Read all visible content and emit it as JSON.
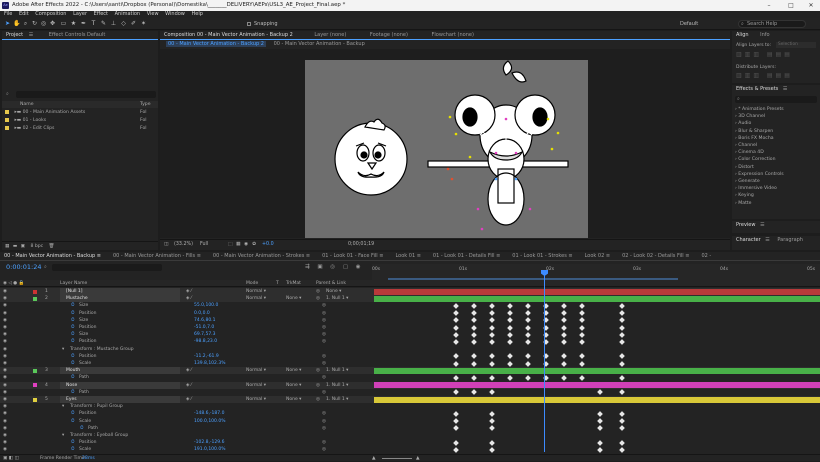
{
  "window": {
    "title": "Adobe After Effects 2022 - C:\\Users\\santi\\Dropbox (Personal)\\Domestika\\_______DELIVERY\\AEPs\\USL3_AE_Project_Final.aep *",
    "logo_text": "Ae"
  },
  "menu": [
    "File",
    "Edit",
    "Composition",
    "Layer",
    "Effect",
    "Animation",
    "View",
    "Window",
    "Help"
  ],
  "toolbar": {
    "snapping": "Snapping",
    "workspace": "Default",
    "search_placeholder": "Search Help"
  },
  "project_panel": {
    "tabs": [
      "Project",
      "Effect Controls Default"
    ],
    "columns": {
      "name": "Name",
      "type": "Type"
    },
    "items": [
      {
        "name": "00 - Main Animation Assets",
        "type": "Fol",
        "color": "#e6c84c"
      },
      {
        "name": "01 - Looks",
        "type": "Fol",
        "color": "#e6c84c"
      },
      {
        "name": "02 - Edit Clips",
        "type": "Fol",
        "color": "#e6c84c"
      }
    ],
    "footer": "8 bpc"
  },
  "comp_panel": {
    "tabs": [
      "Composition 00 - Main Vector Animation - Backup 2",
      "Layer (none)",
      "Footage (none)",
      "Flowchart (none)"
    ],
    "subtabs": [
      "00 - Main Vector Animation - Backup 2",
      "00 - Main Vector Animation - Backup"
    ],
    "zoom": "(33.2%)",
    "quality": "Full",
    "exposure": "+0.0",
    "timecode": "0;00;01;19"
  },
  "right_panel": {
    "align": {
      "tabs": [
        "Align",
        "Info"
      ],
      "align_to_label": "Align Layers to:",
      "align_to_value": "Selection",
      "distribute": "Distribute Layers:"
    },
    "effects": {
      "title": "Effects & Presets",
      "items": [
        "* Animation Presets",
        "3D Channel",
        "Audio",
        "Blur & Sharpen",
        "Boris FX Mocha",
        "Channel",
        "Cinema 4D",
        "Color Correction",
        "Distort",
        "Expression Controls",
        "Generate",
        "Immersive Video",
        "Keying",
        "Matte"
      ]
    },
    "preview": "Preview",
    "character_tabs": [
      "Character",
      "Paragraph"
    ]
  },
  "timeline": {
    "tabs": [
      "00 - Main Vector Animation - Backup",
      "00 - Main Vector Animation - Fills",
      "00 - Main Vector Animation - Strokes",
      "01 - Look 01 - Face Fill",
      "Look 01",
      "01 - Look 01 - Details Fill",
      "01 - Look 01 - Strokes",
      "Look 02",
      "02 - Look 02 - Details Fill",
      "02 -"
    ],
    "timecode": "0:00:01:24",
    "columns": {
      "layer_name": "Layer Name",
      "mode": "Mode",
      "t": "T",
      "trkmat": "TrkMat",
      "parent": "Parent & Link"
    },
    "ruler": [
      "00s",
      "01s",
      "02s",
      "03s",
      "04s",
      "05s"
    ],
    "footer": {
      "label": "Frame Render Time",
      "value": "28ms"
    },
    "rows": [
      {
        "num": "1",
        "name": "[Null 1]",
        "kind": "layer",
        "mode": "Normal",
        "trk": "",
        "parent": "None",
        "color": "#cc3333",
        "bar": "red"
      },
      {
        "num": "2",
        "name": "Mustache",
        "kind": "layer",
        "mode": "Normal",
        "trk": "None",
        "parent": "1. Null 1",
        "color": "#5ac85a",
        "bar": "green"
      },
      {
        "name": "Size",
        "value": "55.0,100.0",
        "indent": 3,
        "kf": [
          0,
          1,
          1,
          1,
          1,
          1,
          1,
          1,
          1,
          0,
          1
        ]
      },
      {
        "name": "Position",
        "value": "0.0,0.0",
        "indent": 3,
        "kf": [
          0,
          1,
          1,
          1,
          1,
          1,
          1,
          1,
          1,
          0,
          1
        ]
      },
      {
        "name": "Size",
        "value": "74.6,80.1",
        "indent": 3,
        "kf": [
          0,
          1,
          1,
          1,
          1,
          1,
          1,
          1,
          1,
          0,
          1
        ]
      },
      {
        "name": "Position",
        "value": "-51.0,7.0",
        "indent": 3,
        "kf": [
          0,
          1,
          1,
          1,
          1,
          1,
          1,
          1,
          1,
          0,
          1
        ]
      },
      {
        "name": "Size",
        "value": "69.7,57.3",
        "indent": 3,
        "kf": [
          0,
          1,
          1,
          1,
          1,
          1,
          1,
          1,
          1,
          0,
          1
        ]
      },
      {
        "name": "Position",
        "value": "-98.8,23.0",
        "indent": 3,
        "kf": [
          0,
          1,
          1,
          1,
          1,
          1,
          1,
          1,
          1,
          0,
          1
        ]
      },
      {
        "name": "Transform : Mustache Group",
        "value": "",
        "indent": 2,
        "kf": []
      },
      {
        "name": "Position",
        "value": "-11.2,-61.9",
        "indent": 3,
        "kf": [
          0,
          1,
          1,
          1,
          1,
          1,
          1,
          1,
          1,
          0,
          1
        ]
      },
      {
        "name": "Scale",
        "value": "139.8,102.3%",
        "indent": 3,
        "kf": [
          0,
          1,
          1,
          1,
          1,
          1,
          1,
          1,
          1,
          0,
          1
        ]
      },
      {
        "num": "3",
        "name": "Mouth",
        "kind": "layer",
        "mode": "Normal",
        "trk": "None",
        "parent": "1. Null 1",
        "color": "#5ac85a",
        "bar": "green"
      },
      {
        "name": "Path",
        "value": "",
        "indent": 3,
        "kf": [
          0,
          1,
          1,
          1,
          1,
          1,
          1,
          1,
          1,
          0,
          1
        ]
      },
      {
        "num": "4",
        "name": "Nose",
        "kind": "layer",
        "mode": "Normal",
        "trk": "None",
        "parent": "1. Null 1",
        "color": "#e040c0",
        "bar": "magenta"
      },
      {
        "name": "Path",
        "value": "",
        "indent": 3,
        "kf": [
          0,
          1,
          1,
          1,
          0,
          0,
          0,
          0,
          0,
          1,
          1
        ]
      },
      {
        "num": "5",
        "name": "Eyes",
        "kind": "layer",
        "mode": "Normal",
        "trk": "None",
        "parent": "1. Null 1",
        "color": "#e0d040",
        "bar": "yellow"
      },
      {
        "name": "Transform : Pupil Group",
        "value": "",
        "indent": 2,
        "kf": []
      },
      {
        "name": "Position",
        "value": "-148.6,-187.0",
        "indent": 3,
        "kf": [
          0,
          1,
          0,
          1,
          0,
          0,
          0,
          0,
          0,
          1,
          1
        ]
      },
      {
        "name": "Scale",
        "value": "100.0,100.0%",
        "indent": 3,
        "kf": [
          0,
          1,
          0,
          1,
          0,
          0,
          0,
          0,
          0,
          1,
          1
        ]
      },
      {
        "name": "Path",
        "value": "",
        "indent": 4,
        "kf": [
          0,
          1,
          0,
          1,
          0,
          0,
          0,
          0,
          0,
          1,
          1
        ]
      },
      {
        "name": "Transform : Eyeball Group",
        "value": "",
        "indent": 2,
        "kf": []
      },
      {
        "name": "Position",
        "value": "-102.8,-129.6",
        "indent": 3,
        "kf": [
          0,
          1,
          0,
          1,
          0,
          0,
          0,
          0,
          0,
          1,
          1
        ]
      },
      {
        "name": "Scale",
        "value": "191.0,100.0%",
        "indent": 3,
        "kf": [
          0,
          1,
          0,
          1,
          0,
          0,
          0,
          0,
          0,
          1,
          1
        ]
      }
    ]
  },
  "colors": {
    "accent": "#4ca0ff",
    "playhead": "#3d8bff",
    "bar_red": "#b83a3a",
    "bar_green": "#48b048",
    "bar_magenta": "#d040b8",
    "bar_yellow": "#d8c838"
  }
}
